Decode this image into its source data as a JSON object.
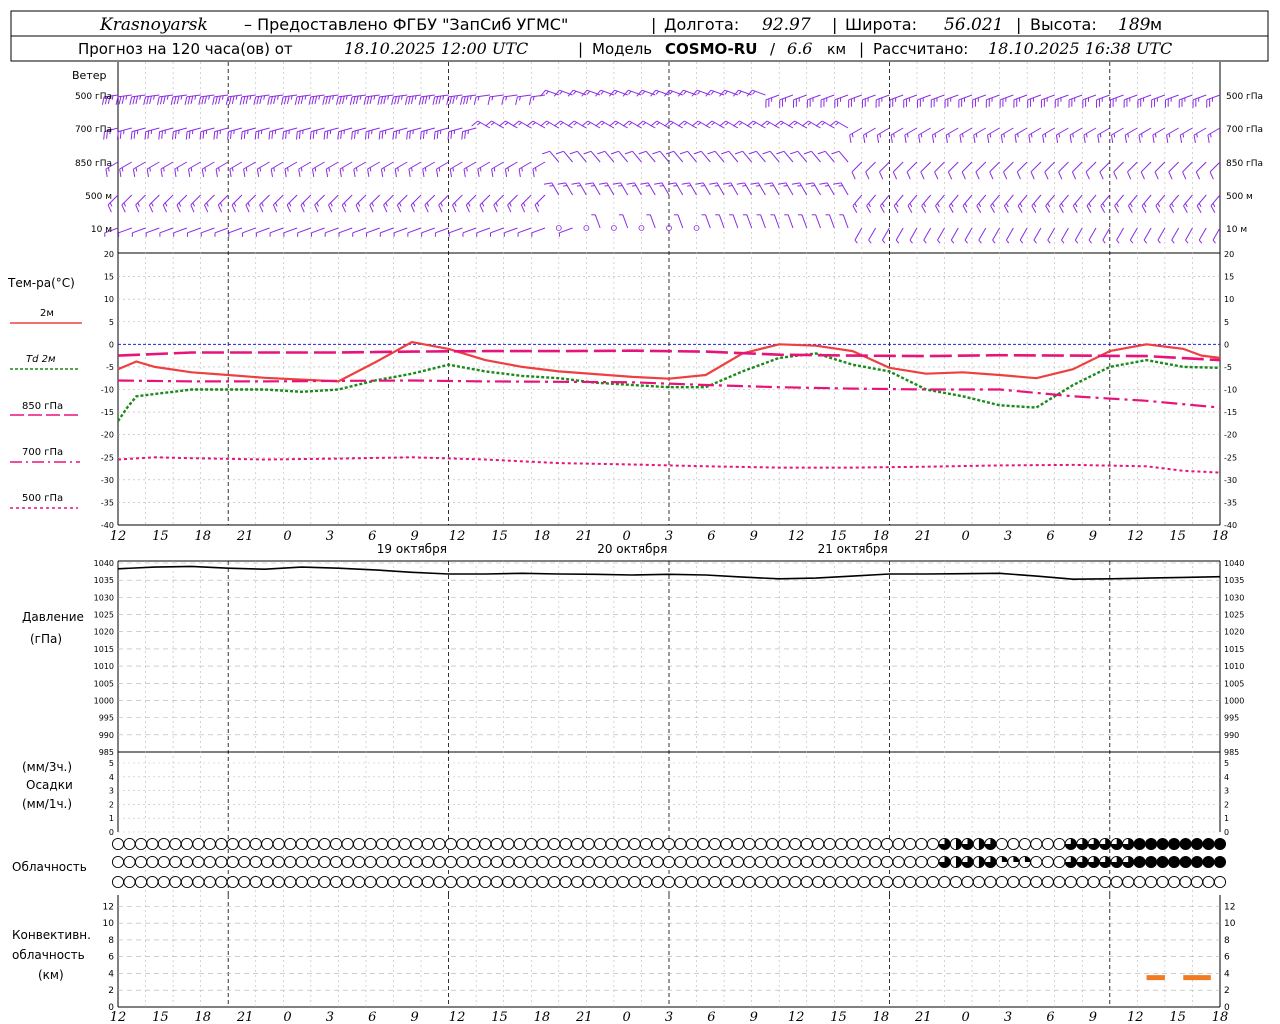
{
  "header": {
    "station": "Krasnoyarsk",
    "provider": "– Предоставлено ФГБУ \"ЗапСиб УГМС\"",
    "lon_label": "Долгота:",
    "lon_value": "92.97",
    "lat_label": "Широта:",
    "lat_value": "56.021",
    "alt_label": "Высота:",
    "alt_value": "189",
    "alt_unit": "м",
    "forecast_label": "Прогноз на 120 часа(ов) от",
    "forecast_time": "18.10.2025 12:00 UTC",
    "model_label": "Модель",
    "model_name": "COSMO-RU",
    "model_res": "6.6",
    "model_res_unit": "км",
    "calc_label": "Рассчитано:",
    "calc_time": "18.10.2025 16:38 UTC"
  },
  "colors": {
    "wind": "#8a2be2",
    "t2m": "#ee4040",
    "td2m": "#1a8a1a",
    "t850": "#e8137a",
    "t700": "#e8137a",
    "t500": "#e8137a",
    "grid": "#a0a0a0",
    "zero": "#2222dd",
    "conv": "#f07b22"
  },
  "chart_data": [
    {
      "type": "wind-barbs",
      "panel_label": "Ветер",
      "levels": [
        "500 гПа",
        "700 гПа",
        "850 гПа",
        "500 м",
        "10 м"
      ],
      "note": "wind barbs per 1-hour step at five levels"
    },
    {
      "type": "line",
      "panel_label": "Тем-ра(°C)",
      "ylim": [
        -40,
        20
      ],
      "yticks": [
        20,
        15,
        10,
        5,
        0,
        -5,
        -10,
        -15,
        -20,
        -25,
        -30,
        -35,
        -40
      ],
      "x_unit": "hours from 18.10.2025 12:00 UTC",
      "series": [
        {
          "name": "2м",
          "x": [
            0,
            2,
            4,
            8,
            12,
            16,
            20,
            24,
            28,
            32,
            36,
            40,
            44,
            48,
            52,
            56,
            60,
            64,
            68,
            72,
            76,
            80,
            84,
            88,
            92,
            96,
            100,
            104,
            108,
            112,
            116,
            118,
            120
          ],
          "values": [
            -5.5,
            -3.8,
            -5,
            -6.2,
            -6.8,
            -7.4,
            -7.8,
            -8.2,
            -4,
            0.5,
            -1,
            -3.5,
            -5,
            -6,
            -6.6,
            -7.2,
            -7.6,
            -6.8,
            -2,
            0,
            -0.3,
            -1.5,
            -5.2,
            -6.5,
            -6.2,
            -6.8,
            -7.5,
            -5.5,
            -1.5,
            0,
            -1,
            -2.5,
            -3
          ]
        },
        {
          "name": "Td 2м",
          "x": [
            0,
            1,
            2,
            4,
            6,
            8,
            10,
            12,
            16,
            20,
            24,
            28,
            32,
            36,
            40,
            44,
            48,
            52,
            56,
            60,
            64,
            68,
            72,
            76,
            80,
            84,
            88,
            92,
            96,
            100,
            104,
            108,
            112,
            116,
            120
          ],
          "values": [
            -17,
            -14,
            -11.5,
            -11,
            -10.5,
            -10,
            -10,
            -10,
            -10,
            -10.5,
            -10,
            -8,
            -6.5,
            -4.5,
            -6,
            -7,
            -7.5,
            -8.5,
            -9,
            -9.5,
            -9.5,
            -6,
            -3,
            -2,
            -4.5,
            -6,
            -10,
            -11.5,
            -13.5,
            -14,
            -9,
            -5,
            -3.5,
            -5,
            -5.2
          ]
        },
        {
          "name": "850 гПа",
          "x": [
            0,
            8,
            16,
            24,
            32,
            40,
            48,
            56,
            64,
            72,
            80,
            88,
            96,
            104,
            112,
            120
          ],
          "values": [
            -2.5,
            -1.8,
            -1.8,
            -1.8,
            -1.6,
            -1.5,
            -1.5,
            -1.4,
            -1.6,
            -2.3,
            -2.5,
            -2.6,
            -2.4,
            -2.5,
            -2.6,
            -3.5
          ]
        },
        {
          "name": "700 гПа",
          "x": [
            0,
            8,
            16,
            24,
            32,
            40,
            48,
            56,
            64,
            72,
            80,
            88,
            96,
            104,
            112,
            120
          ],
          "values": [
            -8,
            -8.2,
            -8.2,
            -8.1,
            -8,
            -8.2,
            -8.3,
            -8.4,
            -9,
            -9.5,
            -9.8,
            -10,
            -10,
            -11.5,
            -12.5,
            -14
          ]
        },
        {
          "name": "500 гПа",
          "x": [
            0,
            4,
            8,
            16,
            24,
            32,
            40,
            48,
            56,
            64,
            72,
            80,
            88,
            96,
            104,
            112,
            116,
            120
          ],
          "values": [
            -25.5,
            -25,
            -25.2,
            -25.5,
            -25.3,
            -25,
            -25.5,
            -26.3,
            -26.6,
            -27,
            -27.3,
            -27.3,
            -27.1,
            -26.8,
            -26.7,
            -27,
            -28,
            -28.4
          ]
        }
      ],
      "legend": [
        "2м",
        "Td 2м",
        "850 гПа",
        "700 гПа",
        "500 гПа"
      ]
    },
    {
      "type": "line",
      "panel_label": "Давление",
      "panel_unit": "(гПа)",
      "ylim": [
        985,
        1040
      ],
      "yticks": [
        1040,
        1035,
        1030,
        1025,
        1020,
        1015,
        1010,
        1005,
        1000,
        995,
        990,
        985
      ],
      "series": [
        {
          "x": [
            0,
            4,
            8,
            12,
            16,
            20,
            24,
            28,
            32,
            36,
            40,
            44,
            48,
            52,
            56,
            60,
            64,
            68,
            72,
            76,
            80,
            84,
            88,
            92,
            96,
            100,
            104,
            108,
            112,
            116,
            120
          ],
          "values": [
            1038.3,
            1038.8,
            1039,
            1038.5,
            1038.2,
            1038.8,
            1038.5,
            1038,
            1037.3,
            1036.8,
            1036.8,
            1037,
            1036.8,
            1036.7,
            1036.5,
            1036.7,
            1036.5,
            1035.9,
            1035.4,
            1035.6,
            1036.2,
            1036.8,
            1036.8,
            1036.9,
            1037,
            1036.2,
            1035.3,
            1035.4,
            1035.6,
            1035.8,
            1036
          ]
        }
      ]
    },
    {
      "type": "bar",
      "panel_label": "Осадки",
      "unit_top": "(мм/3ч.)",
      "unit_bottom": "(мм/1ч.)",
      "ylim": [
        0,
        5
      ],
      "yticks": [
        5,
        4,
        3,
        2,
        1,
        0
      ],
      "values": []
    },
    {
      "type": "cloud-symbols",
      "panel_label": "Облачность",
      "rows": 3,
      "note": "cloud cover symbols per 1-hour step: empty circle = clear, filled = overcast"
    },
    {
      "type": "bar",
      "panel_label": "Конвективн. облачность (км)",
      "ylim": [
        0,
        13
      ],
      "yticks": [
        12,
        10,
        8,
        6,
        4,
        2,
        0
      ],
      "segments": [
        {
          "x_from": 112,
          "x_to": 114,
          "bottom": 3.5
        },
        {
          "x_from": 116,
          "x_to": 119,
          "bottom": 3.5
        }
      ]
    }
  ],
  "axis": {
    "hour_labels": [
      "12",
      "15",
      "18",
      "21",
      "0",
      "3",
      "6",
      "9",
      "12",
      "15",
      "18",
      "21",
      "0",
      "3",
      "6",
      "9",
      "12",
      "15",
      "18",
      "21",
      "0",
      "3",
      "6",
      "9",
      "12",
      "15",
      "18"
    ],
    "day_labels": [
      "19 октября",
      "20 октября",
      "21 октября"
    ]
  }
}
